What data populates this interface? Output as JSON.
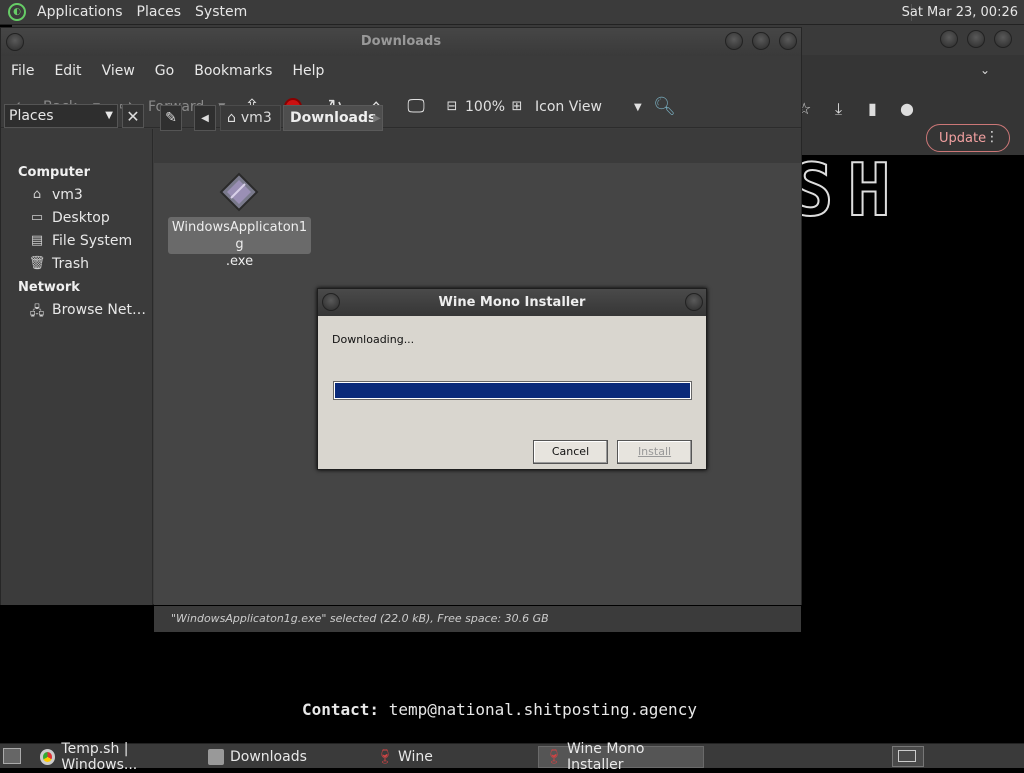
{
  "top_panel": {
    "menus": [
      "Applications",
      "Places",
      "System"
    ],
    "clock": "Sat Mar 23, 00:26"
  },
  "browser": {
    "update_label": "Update",
    "banner_text": "SH",
    "contact_label": "Contact:",
    "contact_value": "temp@national.shitposting.agency"
  },
  "file_manager": {
    "title": "Downloads",
    "menus": [
      "File",
      "Edit",
      "View",
      "Go",
      "Bookmarks",
      "Help"
    ],
    "toolbar": {
      "back": "Back",
      "forward": "Forward",
      "zoom": "100%",
      "view_mode": "Icon View"
    },
    "sidebar": {
      "selector": "Places",
      "sections": [
        {
          "heading": "Computer",
          "items": [
            {
              "label": "vm3",
              "icon": "home-folder-icon"
            },
            {
              "label": "Desktop",
              "icon": "desktop-icon"
            },
            {
              "label": "File System",
              "icon": "drive-icon"
            },
            {
              "label": "Trash",
              "icon": "trash-icon"
            }
          ]
        },
        {
          "heading": "Network",
          "items": [
            {
              "label": "Browse Net…",
              "icon": "network-icon"
            }
          ]
        }
      ]
    },
    "path": [
      "vm3",
      "Downloads"
    ],
    "files": [
      {
        "name": "WindowsApplicaton1g.exe",
        "name_line1": "WindowsApplicaton1g",
        "name_line2": ".exe",
        "icon": "wine-exe-icon"
      }
    ],
    "status": "\"WindowsApplicaton1g.exe\" selected (22.0 kB), Free space: 30.6 GB"
  },
  "dialog": {
    "title": "Wine Mono Installer",
    "message": "Downloading...",
    "progress": 1.0,
    "progress_color": "#0a2a7a",
    "cancel_label": "Cancel",
    "install_label": "Install"
  },
  "taskbar": {
    "items": [
      {
        "label": "Temp.sh | Windows...",
        "icon": "chrome-icon",
        "active": false
      },
      {
        "label": "Downloads",
        "icon": "folder-icon",
        "active": false
      },
      {
        "label": "Wine",
        "icon": "wine-glass-icon",
        "active": false
      },
      {
        "label": "Wine Mono Installer",
        "icon": "wine-glass-icon",
        "active": true
      }
    ]
  }
}
